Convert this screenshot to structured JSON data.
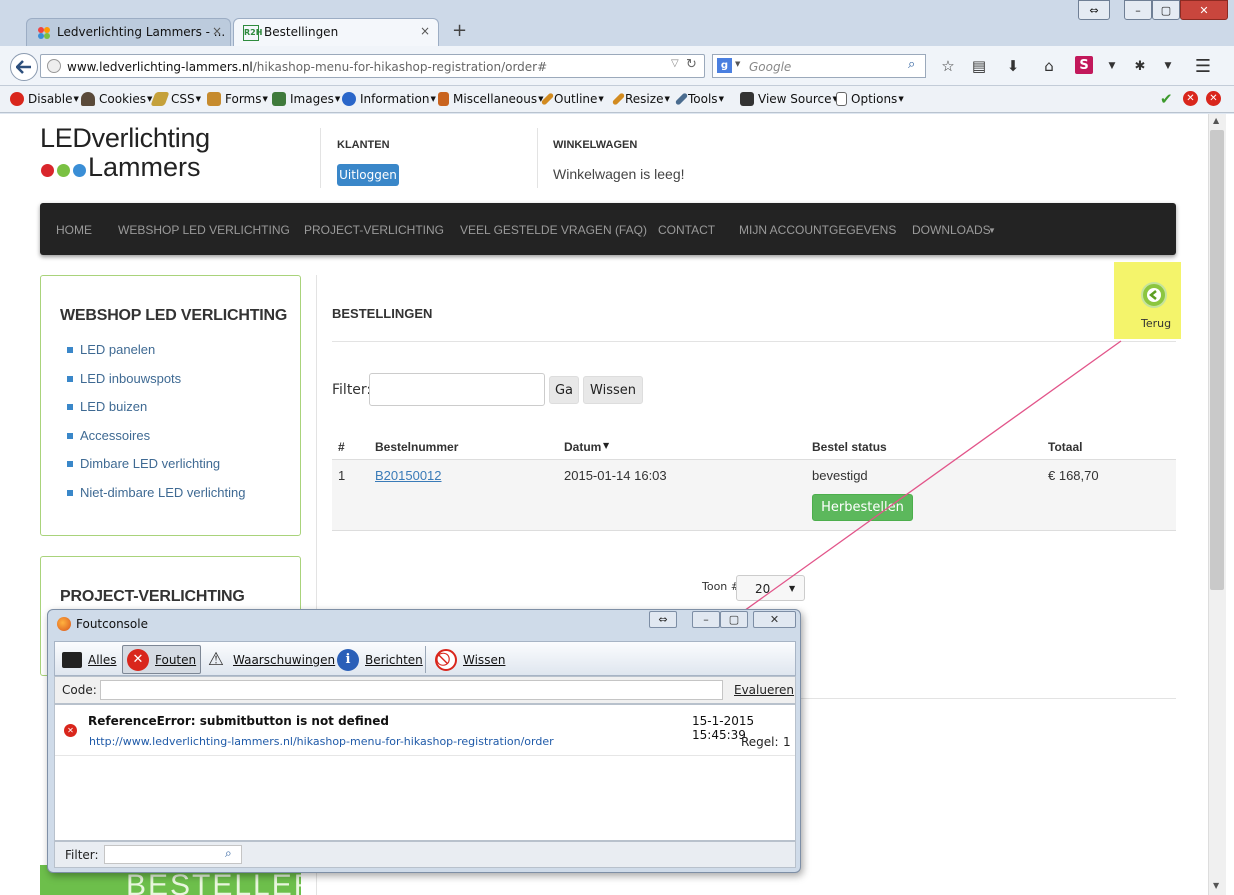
{
  "browser": {
    "tabs": [
      {
        "title": "Ledverlichting Lammers - ...",
        "close": "×"
      },
      {
        "title": "Bestellingen",
        "close": "×"
      }
    ],
    "new_tab": "+",
    "window_buttons": {
      "back": "⇔",
      "minimize": "–",
      "maximize": "▢",
      "close": "✕"
    },
    "url": {
      "domain": "www.ledverlichting-lammers.nl",
      "path": "/hikashop-menu-for-hikashop-registration/order#"
    },
    "search_placeholder": "Google",
    "webdev": [
      {
        "label": "Disable",
        "icon": "disable-icon",
        "color": "#d9261c"
      },
      {
        "label": "Cookies",
        "icon": "cookies-icon",
        "color": "#5a4a3a"
      },
      {
        "label": "CSS",
        "icon": "css-icon",
        "color": "#c5a13b"
      },
      {
        "label": "Forms",
        "icon": "forms-icon",
        "color": "#c68b2e"
      },
      {
        "label": "Images",
        "icon": "images-icon",
        "color": "#3f7a3b"
      },
      {
        "label": "Information",
        "icon": "information-icon",
        "color": "#2a66c9"
      },
      {
        "label": "Miscellaneous",
        "icon": "miscellaneous-icon",
        "color": "#c9641f"
      },
      {
        "label": "Outline",
        "icon": "outline-icon",
        "color": "#d28b20"
      },
      {
        "label": "Resize",
        "icon": "resize-icon",
        "color": "#d28b20"
      },
      {
        "label": "Tools",
        "icon": "tools-icon",
        "color": "#4a6c8f"
      },
      {
        "label": "View Source",
        "icon": "view-source-icon",
        "color": "#333333"
      },
      {
        "label": "Options",
        "icon": "options-icon",
        "color": "#666666"
      }
    ]
  },
  "site": {
    "logo_top": "LEDverlichting",
    "logo_bottom": "Lammers",
    "klanten_label": "KLANTEN",
    "logout_button": "Uitloggen",
    "cart_label": "WINKELWAGEN",
    "cart_text": "Winkelwagen is leeg!",
    "nav": [
      "HOME",
      "WEBSHOP LED VERLICHTING",
      "PROJECT-VERLICHTING",
      "VEEL GESTELDE VRAGEN (FAQ)",
      "CONTACT",
      "MIJN ACCOUNTGEGEVENS",
      "DOWNLOADS"
    ],
    "sidebar": {
      "title": "WEBSHOP LED VERLICHTING",
      "items": [
        "LED panelen",
        "LED inbouwspots",
        "LED buizen",
        "Accessoires",
        "Dimbare LED verlichting",
        "Niet-dimbare LED verlichting"
      ],
      "title2": "PROJECT-VERLICHTING",
      "banner_text": "BESTELLER"
    },
    "orders": {
      "title": "BESTELLINGEN",
      "back_label": "Terug",
      "filter_label": "Filter:",
      "go_button": "Ga",
      "clear_button": "Wissen",
      "columns": [
        "#",
        "Bestelnummer",
        "Datum",
        "Bestel status",
        "Totaal"
      ],
      "rows": [
        {
          "num": "1",
          "order": "B20150012",
          "date": "2015-01-14 16:03",
          "status": "bevestigd",
          "total": "€ 168,70",
          "reorder": "Herbestellen"
        }
      ],
      "show_label": "Toon #",
      "show_value": "20"
    }
  },
  "console": {
    "title": "Foutconsole",
    "buttons": [
      "Alles",
      "Fouten",
      "Waarschuwingen",
      "Berichten",
      "Wissen"
    ],
    "code_label": "Code:",
    "evaluate_button": "Evalueren",
    "error": {
      "message": "ReferenceError: submitbutton is not defined",
      "timestamp": "15-1-2015 15:45:39",
      "url": "http://www.ledverlichting-lammers.nl/hikashop-menu-for-hikashop-registration/order",
      "line_label": "Regel:",
      "line": "1"
    },
    "filter_label": "Filter:"
  }
}
